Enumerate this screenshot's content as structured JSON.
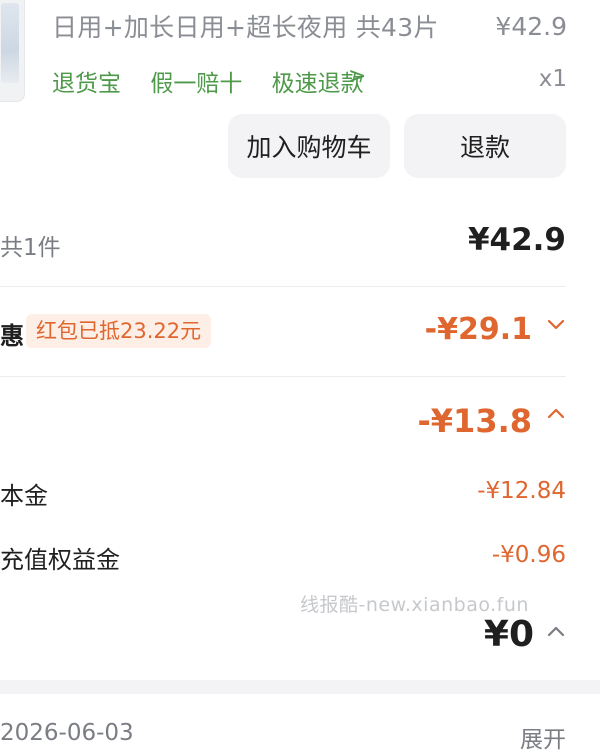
{
  "product": {
    "variant": "日用+加长日用+超长夜用 共43片",
    "unit_price": "¥42.9",
    "tags": [
      "退货宝",
      "假一赔十",
      "极速退款"
    ],
    "tags_arrow": ">",
    "quantity": "x1"
  },
  "actions": {
    "add_to_cart": "加入购物车",
    "refund": "退款"
  },
  "summary": {
    "item_count": "共1件",
    "total": "¥42.9"
  },
  "discount": {
    "label": "惠",
    "redpack_badge": "红包已抵23.22元",
    "amount": "-¥29.1"
  },
  "allowance": {
    "amount": "-¥13.8",
    "items": [
      {
        "label": "本金",
        "value": "-¥12.84"
      },
      {
        "label": "充值权益金",
        "value": "-¥0.96"
      }
    ]
  },
  "watermark": "线报酷-new.xianbao.fun",
  "payment": {
    "amount": "¥0"
  },
  "footer": {
    "date": "2026-06-03",
    "expand_label": "展开"
  },
  "colors": {
    "accent": "#e0662f",
    "tag_green": "#4e9a4a",
    "button_bg": "#f3f3f5",
    "muted_text": "#8a8d93"
  },
  "icons": {
    "chevron_down": "chevron-down-icon",
    "chevron_up": "chevron-up-icon",
    "chevron_right": "chevron-right-icon"
  }
}
